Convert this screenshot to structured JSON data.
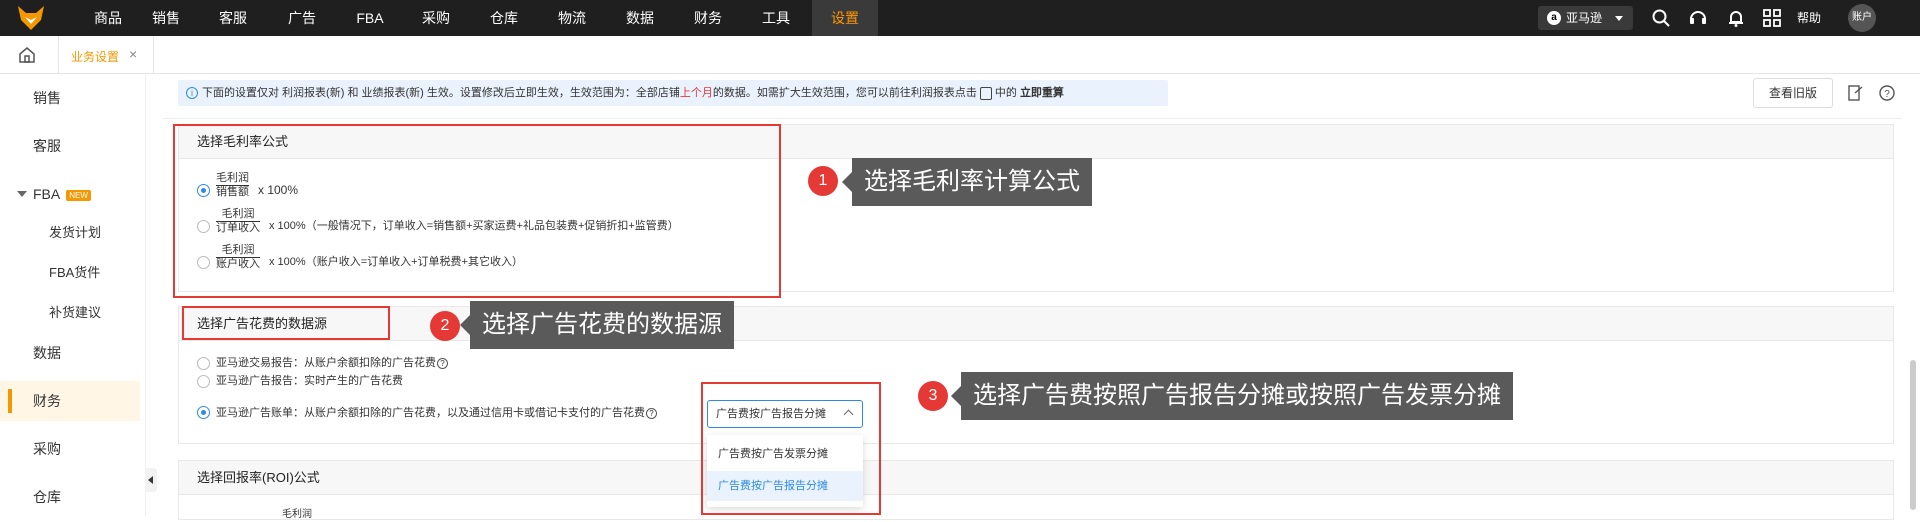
{
  "topnav": {
    "items": [
      "商品",
      "销售",
      "客服",
      "广告",
      "FBA",
      "采购",
      "仓库",
      "物流",
      "数据",
      "财务",
      "工具",
      "设置"
    ],
    "active": "设置",
    "store": "亚马逊",
    "help": "帮助",
    "account": "账户"
  },
  "tabs": {
    "current": "业务设置"
  },
  "sidebar": {
    "items": [
      "销售",
      "客服",
      "FBA",
      "发货计划",
      "FBA货件",
      "补货建议",
      "数据",
      "财务",
      "采购",
      "仓库"
    ],
    "new_badge": "NEW",
    "active": "财务"
  },
  "info": {
    "p1": "下面的设置仅对 利润报表(新) 和 业绩报表(新) 生效。设置修改后立即生效，生效范围为：全部店铺",
    "red": "上个月",
    "p2": "的数据。如需扩大生效范围，您可以前往利润报表点击",
    "p3": "中的",
    "bold": "立即重算",
    "old_version_btn": "查看旧版"
  },
  "margin_section": {
    "title": "选择毛利率公式",
    "options": [
      {
        "num": "毛利润",
        "den": "销售额",
        "tail": "x 100%",
        "checked": true
      },
      {
        "num": "毛利润",
        "den": "订单收入",
        "tail": "x 100%（一般情况下，订单收入=销售额+买家运费+礼品包装费+促销折扣+监管费）",
        "checked": false
      },
      {
        "num": "毛利润",
        "den": "账户收入",
        "tail": "x 100%（账户收入=订单收入+订单税费+其它收入）",
        "checked": false
      }
    ]
  },
  "ad_section": {
    "title": "选择广告花费的数据源",
    "options": [
      {
        "label": "亚马逊交易报告：从账户余额扣除的广告花费",
        "help": true,
        "checked": false
      },
      {
        "label": "亚马逊广告报告：实时产生的广告花费",
        "help": false,
        "checked": false
      },
      {
        "label": "亚马逊广告账单：从账户余额扣除的广告花费，以及通过信用卡或借记卡支付的广告花费",
        "help": true,
        "checked": true
      }
    ],
    "select_value": "广告费按广告报告分摊",
    "dropdown": [
      "广告费按广告发票分摊",
      "广告费按广告报告分摊"
    ],
    "dropdown_selected": "广告费按广告报告分摊"
  },
  "roi_section": {
    "title": "选择回报率(ROI)公式",
    "partial": "毛利润"
  },
  "annotations": [
    {
      "num": "1",
      "text": "选择毛利率计算公式"
    },
    {
      "num": "2",
      "text": "选择广告花费的数据源"
    },
    {
      "num": "3",
      "text": "选择广告费按照广告报告分摊或按照广告发票分摊"
    }
  ],
  "colors": {
    "accent": "#f39800",
    "topbar": "#1f1f1f",
    "primary": "#2e8ae6",
    "annotation_red": "#e53935"
  }
}
